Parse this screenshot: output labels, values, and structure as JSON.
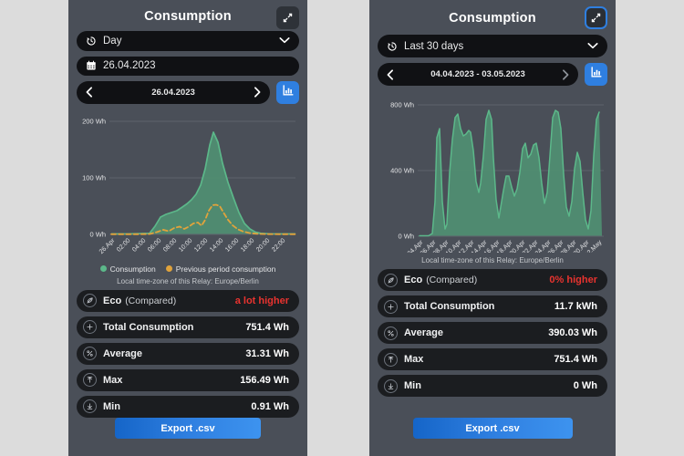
{
  "theme": {
    "page_bg": "#dcdcdc",
    "panel_bg": "#4a4f58",
    "field_bg": "#101114",
    "accent_blue": "#2f7fe0",
    "series_green": "#5cb88a",
    "series_green_fill": "#4f8f72",
    "series_orange": "#e0a33c",
    "warn_red": "#e8332f"
  },
  "panels": [
    {
      "id": "day-view",
      "header": {
        "title": "Consumption",
        "collapse_icon": "collapse-arrows-icon",
        "collapse_focused": false
      },
      "period_select": {
        "icon": "history-icon",
        "value": "Day",
        "chevron": "chevron-down-icon"
      },
      "date_field": {
        "icon": "calendar-icon",
        "value": "26.04.2023",
        "visible": true
      },
      "nav": {
        "prev": "chevron-left-icon",
        "range": "26.04.2023",
        "next": "chevron-right-icon",
        "chart_mode_icon": "bar-chart-icon"
      },
      "legend": [
        {
          "label": "Consumption",
          "color": "#5cb88a"
        },
        {
          "label": "Previous period consumption",
          "color": "#e0a33c"
        }
      ],
      "timezone_note": "Local time-zone of this Relay: Europe/Berlin",
      "stats": [
        {
          "icon": "leaf-icon",
          "label": "Eco",
          "sub": "(Compared)",
          "value": "a lot higher",
          "warn": true
        },
        {
          "icon": "plus-icon",
          "label": "Total Consumption",
          "sub": "",
          "value": "751.4 Wh",
          "warn": false
        },
        {
          "icon": "percent-icon",
          "label": "Average",
          "sub": "",
          "value": "31.31 Wh",
          "warn": false
        },
        {
          "icon": "arrow-up-icon",
          "label": "Max",
          "sub": "",
          "value": "156.49 Wh",
          "warn": false
        },
        {
          "icon": "arrow-down-icon",
          "label": "Min",
          "sub": "",
          "value": "0.91 Wh",
          "warn": false
        }
      ],
      "export_label": "Export .csv"
    },
    {
      "id": "last-30-days-view",
      "header": {
        "title": "Consumption",
        "collapse_icon": "collapse-arrows-icon",
        "collapse_focused": true
      },
      "period_select": {
        "icon": "history-icon",
        "value": "Last 30 days",
        "chevron": "chevron-down-icon"
      },
      "date_field": {
        "icon": "calendar-icon",
        "value": "",
        "visible": false
      },
      "nav": {
        "prev": "chevron-left-icon",
        "range": "04.04.2023 - 03.05.2023",
        "next": "chevron-right-icon",
        "chart_mode_icon": "bar-chart-icon"
      },
      "legend": [],
      "timezone_note": "Local time-zone of this Relay: Europe/Berlin",
      "stats": [
        {
          "icon": "leaf-icon",
          "label": "Eco",
          "sub": "(Compared)",
          "value": "0% higher",
          "warn": true
        },
        {
          "icon": "plus-icon",
          "label": "Total Consumption",
          "sub": "",
          "value": "11.7 kWh",
          "warn": false
        },
        {
          "icon": "percent-icon",
          "label": "Average",
          "sub": "",
          "value": "390.03 Wh",
          "warn": false
        },
        {
          "icon": "arrow-up-icon",
          "label": "Max",
          "sub": "",
          "value": "751.4 Wh",
          "warn": false
        },
        {
          "icon": "arrow-down-icon",
          "label": "Min",
          "sub": "",
          "value": "0 Wh",
          "warn": false
        }
      ],
      "export_label": "Export .csv"
    }
  ],
  "chart_data": [
    {
      "id": "day-chart",
      "type": "area",
      "title": "",
      "xlabel": "",
      "ylabel": "Wh",
      "ylim": [
        0,
        200
      ],
      "yticks": [
        0,
        100,
        200
      ],
      "ytick_labels": [
        "0 Wh",
        "100 Wh",
        "200 Wh"
      ],
      "grid": true,
      "legend_position": "bottom",
      "xticks": [
        "26.Apr",
        "02:00",
        "04:00",
        "06:00",
        "08:00",
        "10:00",
        "12:00",
        "14:00",
        "16:00",
        "18:00",
        "20:00",
        "22:00"
      ],
      "x": [
        "00:00",
        "01:00",
        "02:00",
        "03:00",
        "04:00",
        "05:00",
        "06:00",
        "07:00",
        "08:00",
        "09:00",
        "10:00",
        "11:00",
        "12:00",
        "13:00",
        "14:00",
        "15:00",
        "16:00",
        "17:00",
        "18:00",
        "19:00",
        "20:00",
        "21:00",
        "22:00",
        "23:00"
      ],
      "series": [
        {
          "name": "Consumption",
          "color": "#5cb88a",
          "style": "solid-area",
          "values": [
            0.91,
            0.91,
            0.91,
            0.91,
            0.91,
            0.91,
            1.2,
            22,
            30,
            34,
            40,
            46,
            52,
            60,
            78,
            118,
            156.49,
            92,
            58,
            35,
            14,
            4,
            1.5,
            1.0
          ]
        },
        {
          "name": "Previous period consumption",
          "color": "#e0a33c",
          "style": "dashed-line",
          "values": [
            0.5,
            0.5,
            0.5,
            0.5,
            0.5,
            0.5,
            0.6,
            2,
            6,
            12,
            9,
            13,
            8,
            11,
            22,
            50,
            58,
            40,
            16,
            10,
            6,
            2,
            1,
            0.8
          ]
        }
      ]
    },
    {
      "id": "last-30-days-chart",
      "type": "area",
      "title": "",
      "xlabel": "",
      "ylabel": "Wh",
      "ylim": [
        0,
        800
      ],
      "yticks": [
        0,
        400,
        800
      ],
      "ytick_labels": [
        "0 Wh",
        "400 Wh",
        "800 Wh"
      ],
      "grid": true,
      "legend_position": "none",
      "xticks": [
        "04.Apr",
        "06.Apr",
        "08.Apr",
        "10.Apr",
        "12.Apr",
        "14.Apr",
        "16.Apr",
        "18.Apr",
        "20.Apr",
        "22.Apr",
        "24.Apr",
        "26.Apr",
        "28.Apr",
        "30.Apr",
        "02.May"
      ],
      "x": [
        "04.Apr",
        "05.Apr",
        "06.Apr",
        "07.Apr",
        "08.Apr",
        "09.Apr",
        "10.Apr",
        "11.Apr",
        "12.Apr",
        "13.Apr",
        "14.Apr",
        "15.Apr",
        "16.Apr",
        "17.Apr",
        "18.Apr",
        "19.Apr",
        "20.Apr",
        "21.Apr",
        "22.Apr",
        "23.Apr",
        "24.Apr",
        "25.Apr",
        "26.Apr",
        "27.Apr",
        "28.Apr",
        "29.Apr",
        "30.Apr",
        "01.May",
        "02.May",
        "03.May"
      ],
      "series": [
        {
          "name": "Consumption",
          "color": "#5cb88a",
          "style": "solid-area",
          "values": [
            0,
            0,
            600,
            60,
            580,
            700,
            560,
            590,
            230,
            270,
            730,
            350,
            60,
            150,
            330,
            360,
            230,
            560,
            430,
            540,
            550,
            190,
            740,
            720,
            170,
            170,
            560,
            320,
            60,
            680
          ]
        }
      ]
    }
  ]
}
